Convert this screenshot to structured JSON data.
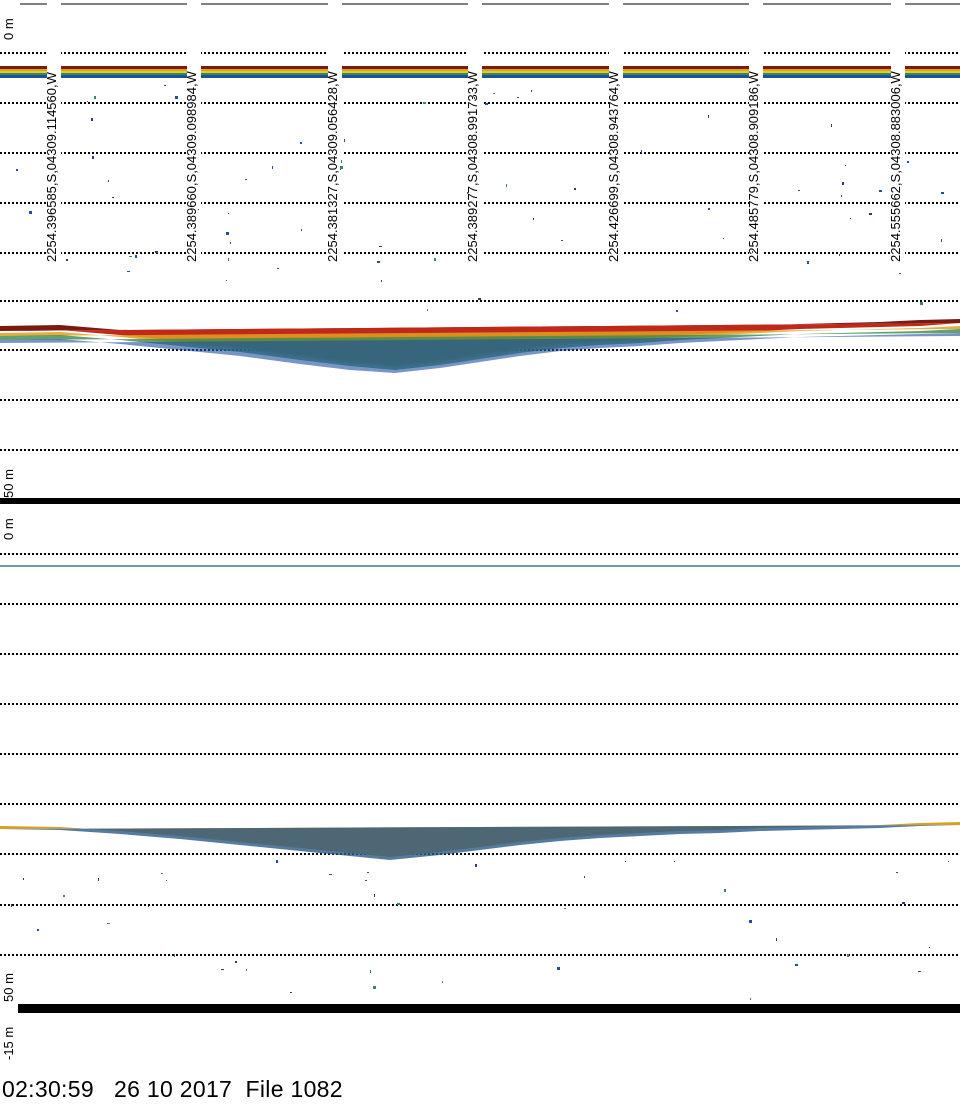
{
  "top_panel": {
    "depth_top_label": "0 m",
    "depth_bottom_label": "50 m",
    "gps_labels": [
      "2254.396585,S,04309.114560,W",
      "2254.389660,S,04309.098984,W",
      "2254.381327,S,04309.056428,W",
      "2254.389277,S,04308.991733,W",
      "2254.426699,S,04308.943764,W",
      "2254.485779,S,04308.909186,W",
      "2254.555662,S,04308.883006,W"
    ]
  },
  "bottom_panel": {
    "depth_top_label": "0 m",
    "depth_bottom_label": "50 m",
    "scale_label": "-15 m"
  },
  "footer": {
    "time": "02:30:59",
    "date": "26 10 2017",
    "file": "File 1082"
  },
  "colors": {
    "echo_dark": "#7a1a10",
    "echo_red": "#c0281a",
    "echo_orange": "#e0a020",
    "echo_yellow": "#d8d030",
    "echo_green": "#3a8a50",
    "echo_blue": "#1f4fa0",
    "gridline": "#000000"
  }
}
